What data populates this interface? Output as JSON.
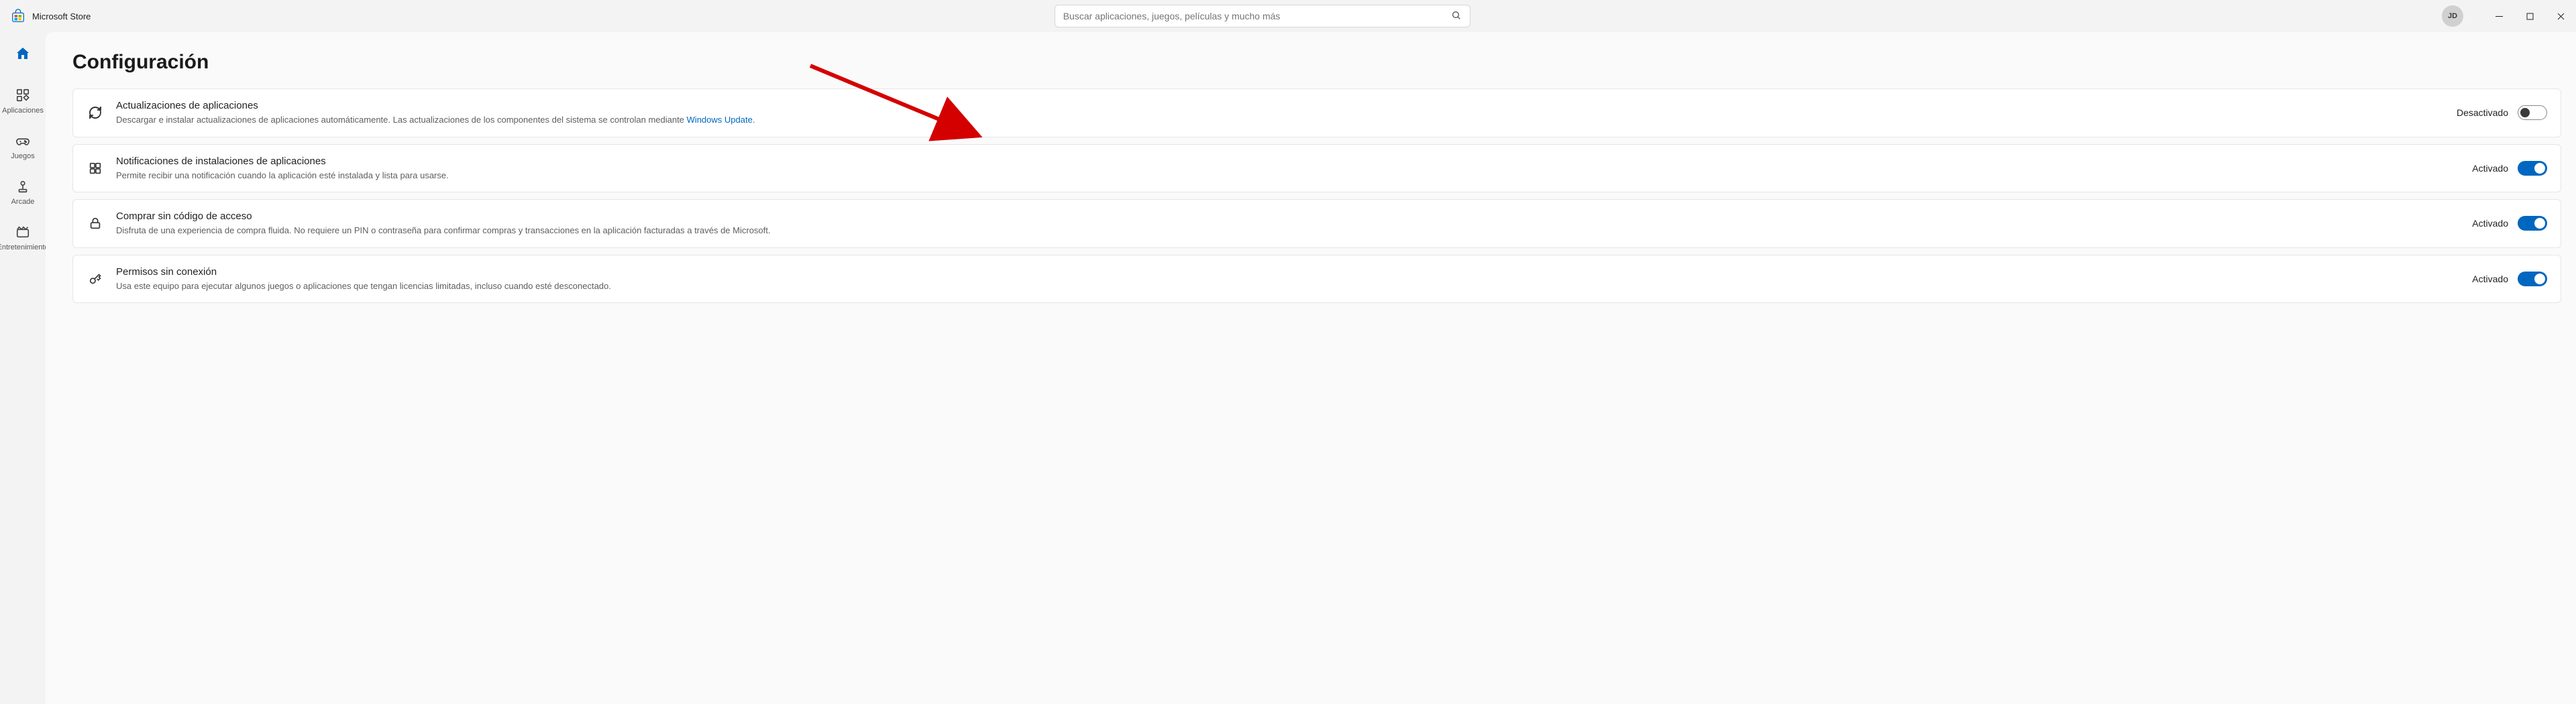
{
  "app": {
    "title": "Microsoft Store"
  },
  "search": {
    "placeholder": "Buscar aplicaciones, juegos, películas y mucho más"
  },
  "user": {
    "initials": "JD"
  },
  "sidebar": {
    "items": [
      {
        "label": ""
      },
      {
        "label": "Aplicaciones"
      },
      {
        "label": "Juegos"
      },
      {
        "label": "Arcade"
      },
      {
        "label": "Entretenimiento"
      }
    ]
  },
  "page": {
    "title": "Configuración"
  },
  "settings": [
    {
      "title": "Actualizaciones de aplicaciones",
      "desc_pre": "Descargar e instalar actualizaciones de aplicaciones automáticamente. Las actualizaciones de los componentes del sistema se controlan mediante ",
      "link": "Windows Update",
      "desc_post": ".",
      "state_label": "Desactivado",
      "on": false
    },
    {
      "title": "Notificaciones de instalaciones de aplicaciones",
      "desc_pre": "Permite recibir una notificación cuando la aplicación esté instalada y lista para usarse.",
      "link": "",
      "desc_post": "",
      "state_label": "Activado",
      "on": true
    },
    {
      "title": "Comprar sin código de acceso",
      "desc_pre": "Disfruta de una experiencia de compra fluida. No requiere un PIN o contraseña para confirmar compras y transacciones en la aplicación facturadas a través de Microsoft.",
      "link": "",
      "desc_post": "",
      "state_label": "Activado",
      "on": true
    },
    {
      "title": "Permisos sin conexión",
      "desc_pre": "Usa este equipo para ejecutar algunos juegos o aplicaciones que tengan licencias limitadas, incluso cuando esté desconectado.",
      "link": "",
      "desc_post": "",
      "state_label": "Activado",
      "on": true
    }
  ]
}
